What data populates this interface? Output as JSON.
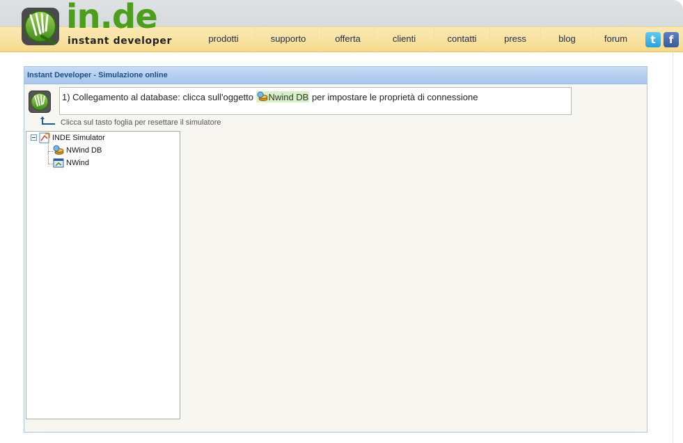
{
  "header": {
    "brand": "in.de",
    "tagline": "instant developer",
    "nav": [
      {
        "label": "prodotti"
      },
      {
        "label": "supporto"
      },
      {
        "label": "offerta"
      },
      {
        "label": "clienti"
      },
      {
        "label": "contatti"
      },
      {
        "label": "press"
      },
      {
        "label": "blog"
      },
      {
        "label": "forum"
      }
    ],
    "social": [
      {
        "icon": "twitter-icon",
        "glyph": "t"
      },
      {
        "icon": "facebook-icon",
        "glyph": "f"
      }
    ]
  },
  "panel": {
    "title": "Instant Developer - Simulazione online",
    "instruction": {
      "prefix": "1) Collegamento al database: clicca sull'oggetto ",
      "object_label": "Nwind DB",
      "suffix": " per impostare le proprietà di connessione"
    },
    "reset_hint": "Clicca sul tasto foglia per resettare il simulatore",
    "tree": {
      "root": {
        "label": "INDE Simulator",
        "icon": "project-icon",
        "expanded": true
      },
      "children": [
        {
          "label": "NWind DB",
          "icon": "database-icon"
        },
        {
          "label": "NWind",
          "icon": "application-icon"
        }
      ]
    }
  },
  "colors": {
    "brand_green": "#4c9e1b",
    "nav_band": "#f9e3a5",
    "panel_title_text": "#1b4f86",
    "highlight": "#d8efc8"
  }
}
